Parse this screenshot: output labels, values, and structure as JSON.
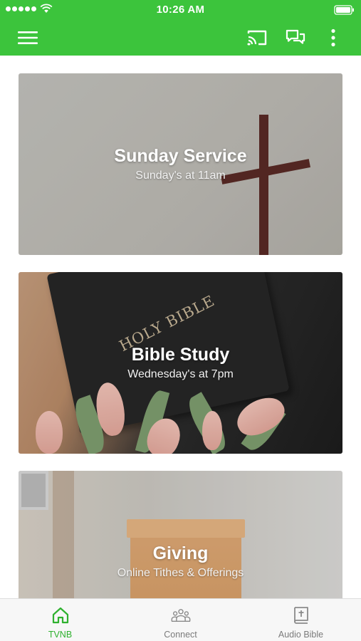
{
  "status_bar": {
    "time": "10:26 AM",
    "signal_icon": "signal-dots-icon",
    "wifi_icon": "wifi-icon",
    "battery_icon": "battery-icon"
  },
  "app_bar": {
    "menu_icon": "hamburger-menu-icon",
    "cast_icon": "cast-icon",
    "chat_icon": "chat-bubbles-icon",
    "more_icon": "more-vertical-icon",
    "color": "#3cc43c"
  },
  "cards": [
    {
      "title": "Sunday Service",
      "subtitle": "Sunday's at 11am"
    },
    {
      "title": "Bible Study",
      "subtitle": "Wednesday's at 7pm",
      "book_text": "HOLY BIBLE"
    },
    {
      "title": "Giving",
      "subtitle": "Online Tithes & Offerings"
    }
  ],
  "tab_bar": {
    "tabs": [
      {
        "label": "TVNB",
        "icon": "home-icon",
        "active": true
      },
      {
        "label": "Connect",
        "icon": "people-group-icon",
        "active": false
      },
      {
        "label": "Audio Bible",
        "icon": "bible-book-icon",
        "active": false
      }
    ],
    "active_color": "#2fb12f",
    "inactive_color": "#7b7b7b"
  }
}
